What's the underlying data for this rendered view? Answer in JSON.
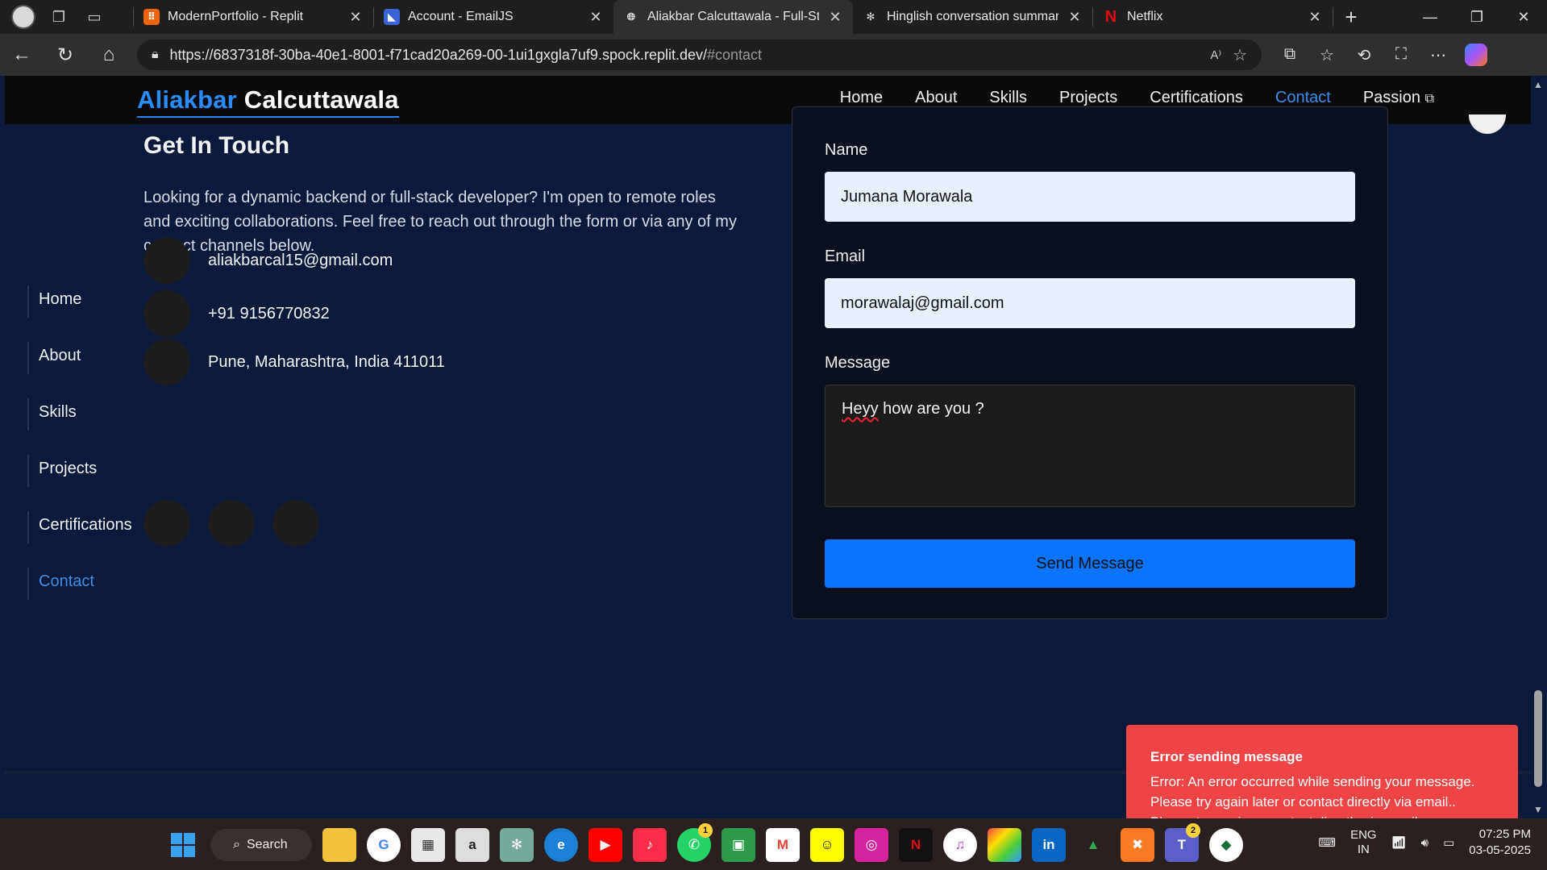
{
  "browser": {
    "tabs": [
      {
        "title": "ModernPortfolio - Replit",
        "active": false,
        "favicon_color": "#f26207"
      },
      {
        "title": "Account - EmailJS",
        "active": false,
        "favicon_color": "#3a63d8"
      },
      {
        "title": "Aliakbar Calcuttawala - Full-Stack",
        "active": true,
        "favicon_color": "#cfcfcf"
      },
      {
        "title": "Hinglish conversation summary",
        "active": false,
        "favicon_color": "#dcdcdc"
      },
      {
        "title": "Netflix",
        "active": false,
        "favicon_color": "#e50914"
      }
    ],
    "url_host": "https://6837318f-30ba-40e1-8001-f71cad20a269-00-1ui1gxgla7uf9.spock.replit.dev/",
    "url_fragment": "#contact"
  },
  "site": {
    "logo_first": "Aliakbar",
    "logo_last": "Calcuttawala",
    "nav": [
      "Home",
      "About",
      "Skills",
      "Projects",
      "Certifications",
      "Contact",
      "Passion"
    ],
    "active_nav": "Contact",
    "side_nav": [
      "Home",
      "About",
      "Skills",
      "Projects",
      "Certifications",
      "Contact"
    ]
  },
  "contact": {
    "heading": "Get In Touch",
    "intro": "Looking for a dynamic backend or full-stack developer? I'm open to remote roles and exciting collaborations. Feel free to reach out through the form or via any of my contact channels below.",
    "email": "aliakbarcal15@gmail.com",
    "phone": "+91 9156770832",
    "location": "Pune, Maharashtra, India 411011"
  },
  "form": {
    "name_label": "Name",
    "name_value": "Jumana Morawala",
    "email_label": "Email",
    "email_value": "morawalaj@gmail.com",
    "message_label": "Message",
    "message_word1": "Heyy",
    "message_rest": " how are you ?",
    "send_label": "Send Message"
  },
  "toast": {
    "title": "Error sending message",
    "body": "Error: An error occurred while sending your message. Please try again later or contact directly via email.. Please try again or contact directly via email."
  },
  "taskbar": {
    "search_label": "Search",
    "whatsapp_badge": "1",
    "teams_badge": "2",
    "lang_top": "ENG",
    "lang_bottom": "IN",
    "time": "07:25 PM",
    "date": "03-05-2025"
  },
  "colors": {
    "accent": "#2b8cff",
    "page_bg": "#0b1a3a",
    "toast_bg": "#ef4444",
    "button_bg": "#0a74ff"
  }
}
